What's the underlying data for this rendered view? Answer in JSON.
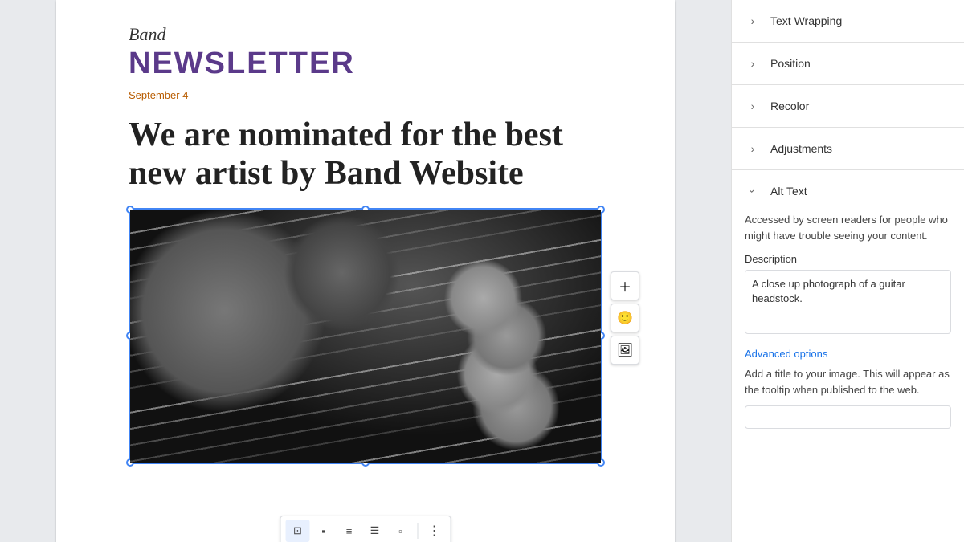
{
  "document": {
    "band_script": "Band",
    "band_title": "NEWSLETTER",
    "date": "September 4",
    "headline": "We are nominated for the best new artist by Band Website"
  },
  "image_toolbar": {
    "add_btn": "＋",
    "emoji_btn": "😊",
    "image_btn": "🖼"
  },
  "bottom_toolbar": {
    "buttons": [
      {
        "label": "⊡",
        "active": true,
        "name": "wrap-inline"
      },
      {
        "label": "⬛",
        "active": false,
        "name": "wrap-left-text"
      },
      {
        "label": "☰",
        "active": false,
        "name": "wrap-break"
      },
      {
        "label": "≡",
        "active": false,
        "name": "wrap-wrap"
      },
      {
        "label": "⬜",
        "active": false,
        "name": "wrap-right"
      }
    ],
    "more_label": "⋮"
  },
  "right_panel": {
    "sections": [
      {
        "label": "Text Wrapping",
        "expanded": false,
        "name": "text-wrapping"
      },
      {
        "label": "Position",
        "expanded": false,
        "name": "position"
      },
      {
        "label": "Recolor",
        "expanded": false,
        "name": "recolor"
      },
      {
        "label": "Adjustments",
        "expanded": false,
        "name": "adjustments"
      }
    ],
    "alt_text": {
      "label": "Alt Text",
      "description": "Accessed by screen readers for people who might have trouble seeing your content.",
      "description_field_label": "Description",
      "description_value": "A close up photograph of a guitar headstock.",
      "advanced_options_label": "Advanced options",
      "advanced_options_desc": "Add a title to your image. This will appear as the tooltip when published to the web.",
      "title_value": ""
    }
  }
}
